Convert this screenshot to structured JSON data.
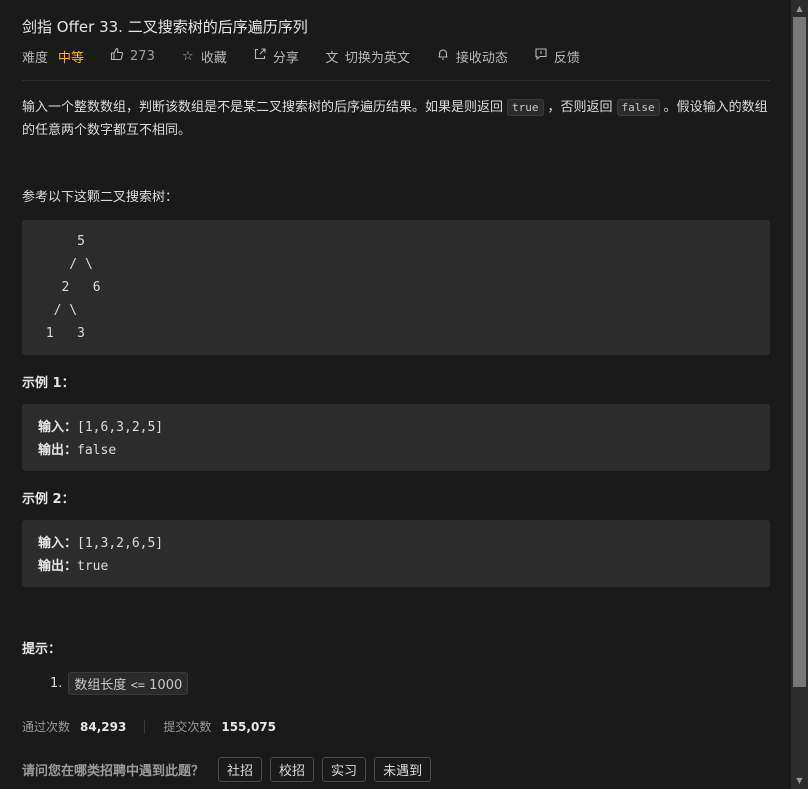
{
  "problem": {
    "title": "剑指 Offer 33. 二叉搜索树的后序遍历序列",
    "difficulty_label": "难度",
    "difficulty": "中等",
    "likes": "273",
    "favorite_label": "收藏",
    "share_label": "分享",
    "translate_label": "切换为英文",
    "subscribe_label": "接收动态",
    "feedback_label": "反馈",
    "description_parts": [
      "输入一个整数数组，判断该数组是不是某二叉搜索树的后序遍历结果。如果是则返回",
      "true",
      "，否则返回",
      "false",
      "。假设输入的数组的任意两个数字都互不相同。"
    ],
    "reference": "参考以下这颗二叉搜索树：",
    "tree_lines": [
      "     5",
      "    / \\",
      "   2   6",
      "  / \\",
      " 1   3"
    ],
    "examples": [
      {
        "heading": "示例 1：",
        "input_label": "输入",
        "input": "[1,6,3,2,5]",
        "output_label": "输出",
        "output": "false"
      },
      {
        "heading": "示例 2：",
        "input_label": "输入",
        "input": "[1,3,2,6,5]",
        "output_label": "输出",
        "output": "true"
      }
    ],
    "hint_heading": "提示：",
    "hints": [
      {
        "number": "1.",
        "text": "数组长度",
        "op": "<=",
        "value": "1000"
      }
    ],
    "stats": {
      "accepted_label": "通过次数",
      "accepted": "84,293",
      "submitted_label": "提交次数",
      "submitted": "155,075"
    },
    "survey": {
      "question": "请问您在哪类招聘中遇到此题？",
      "options": [
        "社招",
        "校招",
        "实习",
        "未遇到"
      ]
    }
  },
  "colors": {
    "background": "#1a1a1a",
    "difficulty": "#ffb800",
    "code_bg": "#2c2c2c"
  },
  "icons": [
    "thumbs-up-icon",
    "star-icon",
    "share-icon",
    "translate-icon",
    "bell-icon",
    "feedback-icon"
  ]
}
